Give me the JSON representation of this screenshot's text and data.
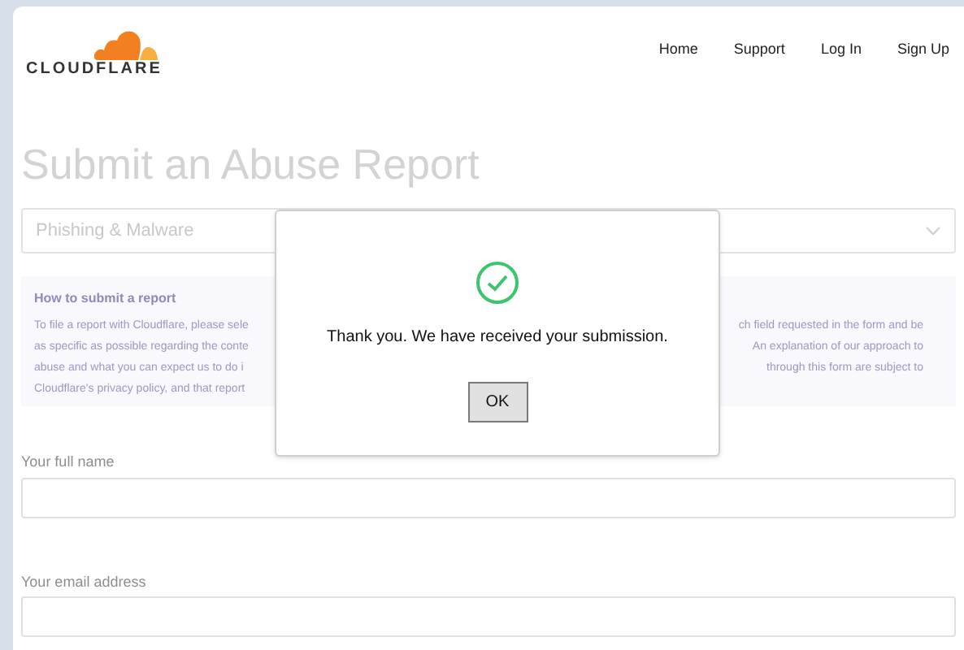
{
  "header": {
    "logo_text": "CLOUDFLARE",
    "nav": [
      "Home",
      "Support",
      "Log In",
      "Sign Up"
    ]
  },
  "page_title": "Submit an Abuse Report",
  "category_select": {
    "value": "Phishing & Malware"
  },
  "info": {
    "heading": "How to submit a report",
    "lines": [
      {
        "left": "To file a report with Cloudflare, please sele",
        "right": "ch field requested in the form and be"
      },
      {
        "left": "as specific as possible regarding the conte",
        "right": "An explanation of our approach to"
      },
      {
        "left": "abuse and what you can expect us to do i",
        "right": "through this form are subject to"
      },
      {
        "left": "Cloudflare's privacy policy, and that report"
      }
    ]
  },
  "fields": [
    {
      "label": "Your full name"
    },
    {
      "label": "Your email address"
    }
  ],
  "dialog": {
    "message": "Thank you. We have received your submission.",
    "button": "OK"
  }
}
